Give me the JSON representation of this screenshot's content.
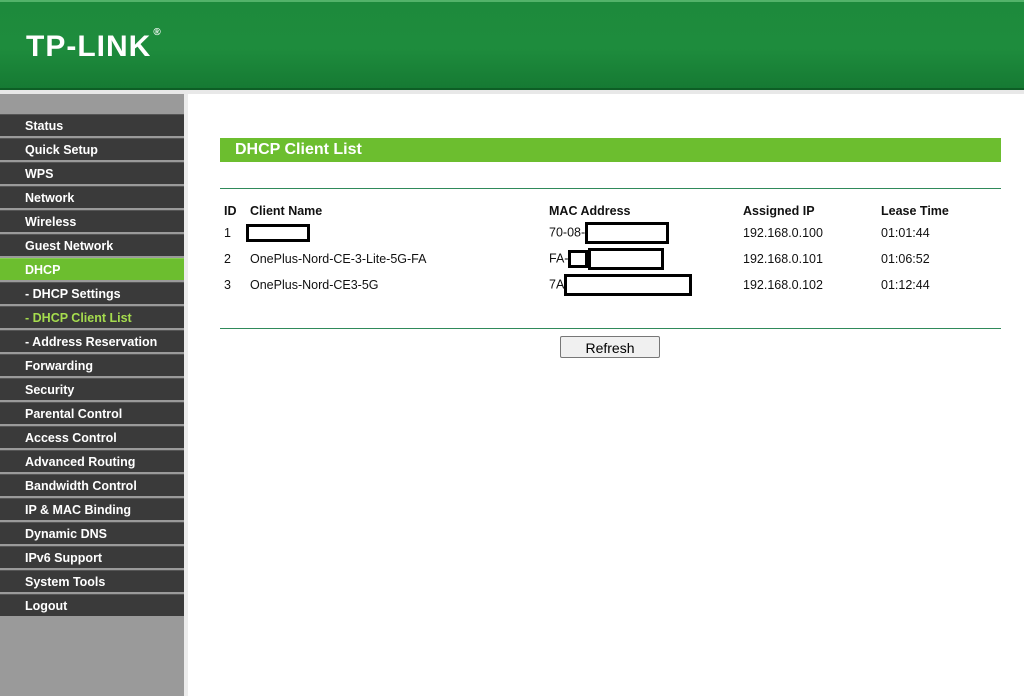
{
  "brand": {
    "logo": "TP-LINK",
    "mark": "®"
  },
  "sidebar": {
    "items": [
      {
        "label": "Status"
      },
      {
        "label": "Quick Setup"
      },
      {
        "label": "WPS"
      },
      {
        "label": "Network"
      },
      {
        "label": "Wireless"
      },
      {
        "label": "Guest Network"
      },
      {
        "label": "DHCP"
      },
      {
        "label": "- DHCP Settings"
      },
      {
        "label": "- DHCP Client List"
      },
      {
        "label": "- Address Reservation"
      },
      {
        "label": "Forwarding"
      },
      {
        "label": "Security"
      },
      {
        "label": "Parental Control"
      },
      {
        "label": "Access Control"
      },
      {
        "label": "Advanced Routing"
      },
      {
        "label": "Bandwidth Control"
      },
      {
        "label": "IP & MAC Binding"
      },
      {
        "label": "Dynamic DNS"
      },
      {
        "label": "IPv6 Support"
      },
      {
        "label": "System Tools"
      },
      {
        "label": "Logout"
      }
    ]
  },
  "main": {
    "title": "DHCP Client List",
    "columns": [
      "ID",
      "Client Name",
      "MAC Address",
      "Assigned IP",
      "Lease Time"
    ],
    "rows": [
      {
        "id": "1",
        "name": "",
        "mac": "70-08-",
        "ip": "192.168.0.100",
        "lease": "01:01:44"
      },
      {
        "id": "2",
        "name": "OnePlus-Nord-CE-3-Lite-5G-FA",
        "mac": "FA-",
        "ip": "192.168.0.101",
        "lease": "01:06:52"
      },
      {
        "id": "3",
        "name": "OnePlus-Nord-CE3-5G",
        "mac": "7A",
        "ip": "192.168.0.102",
        "lease": "01:12:44"
      }
    ],
    "refresh_label": "Refresh"
  }
}
